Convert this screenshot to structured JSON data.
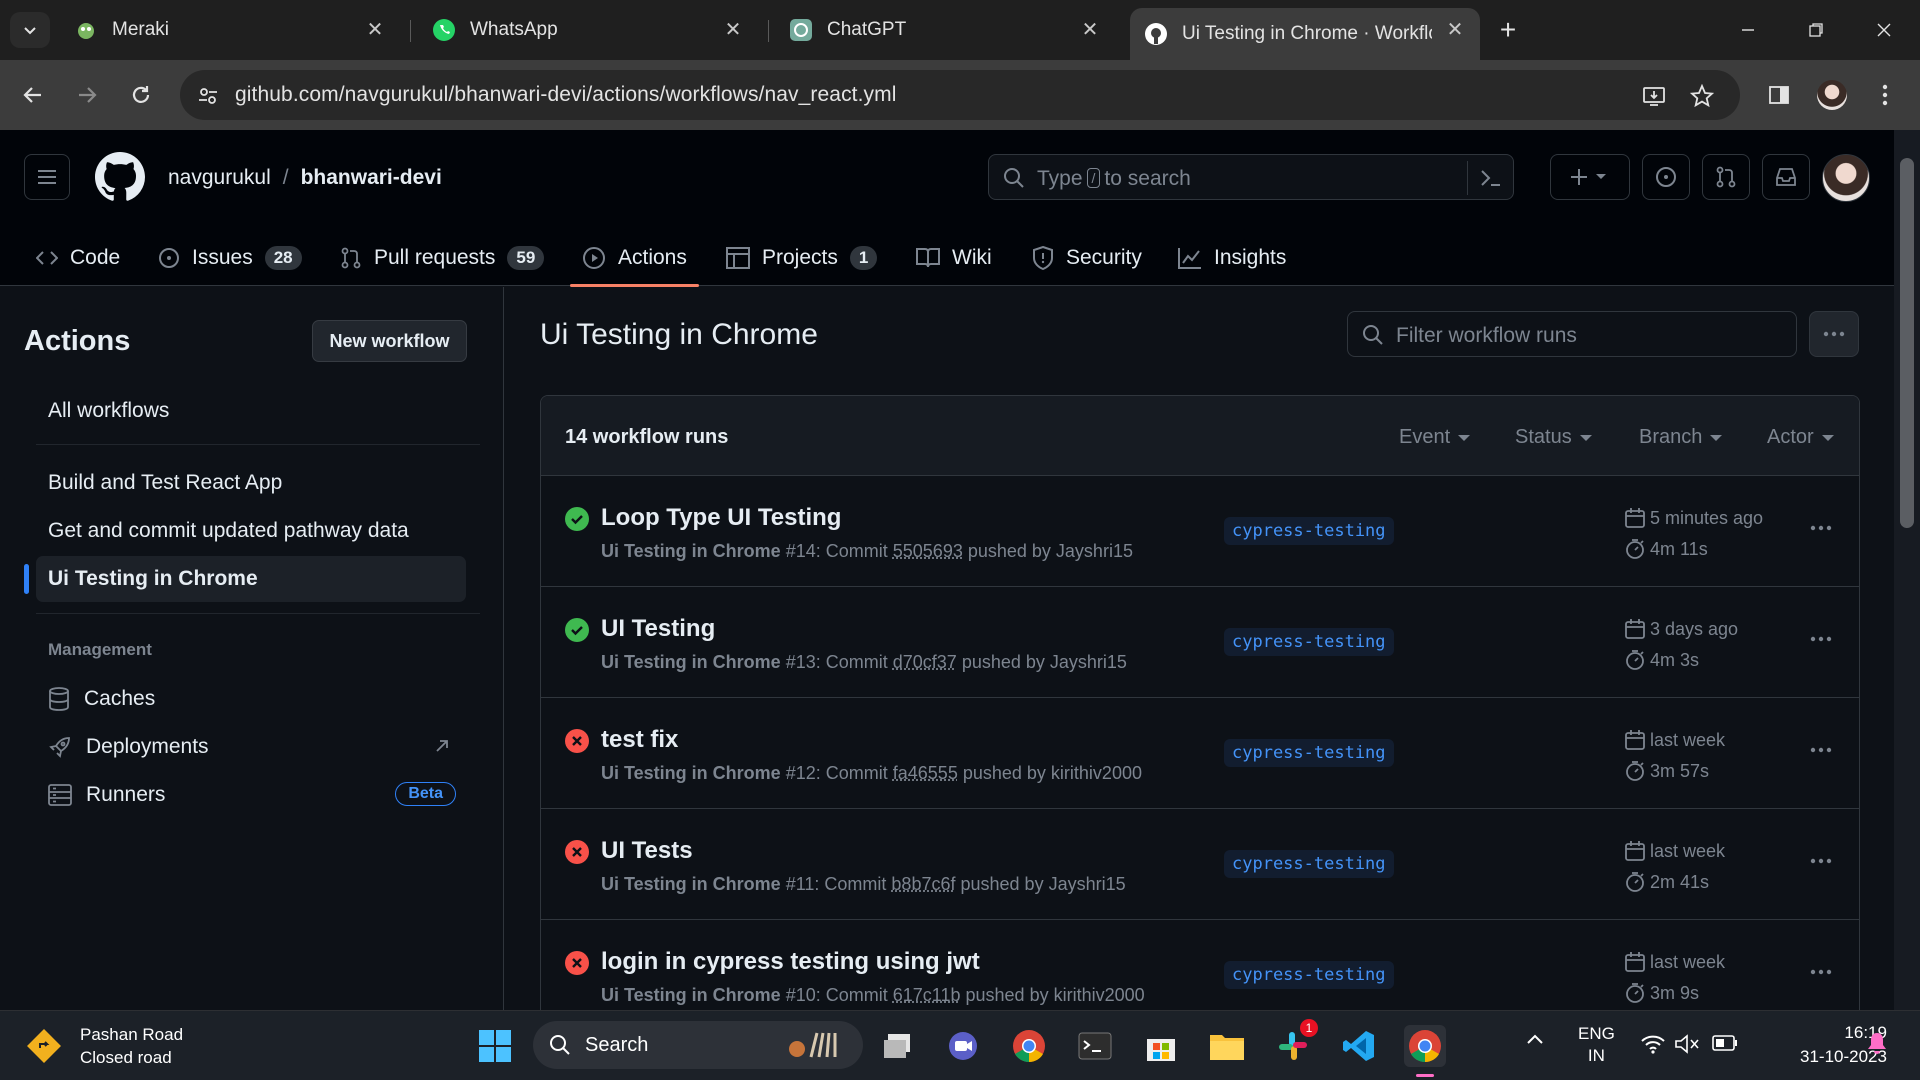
{
  "browser": {
    "tabs": [
      {
        "title": "Meraki"
      },
      {
        "title": "WhatsApp"
      },
      {
        "title": "ChatGPT"
      },
      {
        "title": "Ui Testing in Chrome · Workflo"
      }
    ],
    "url": "github.com/navgurukul/bhanwari-devi/actions/workflows/nav_react.yml"
  },
  "header": {
    "owner": "navgurukul",
    "separator": "/",
    "repo": "bhanwari-devi",
    "search_prefix": "Type",
    "search_key": "/",
    "search_suffix": "to search"
  },
  "repo_nav": [
    {
      "label": "Code",
      "icon": "code-icon"
    },
    {
      "label": "Issues",
      "count": "28",
      "icon": "issue-icon"
    },
    {
      "label": "Pull requests",
      "count": "59",
      "icon": "pull-request-icon"
    },
    {
      "label": "Actions",
      "icon": "play-icon",
      "active": true
    },
    {
      "label": "Projects",
      "count": "1",
      "icon": "table-icon"
    },
    {
      "label": "Wiki",
      "icon": "book-icon"
    },
    {
      "label": "Security",
      "icon": "shield-icon"
    },
    {
      "label": "Insights",
      "icon": "graph-icon"
    }
  ],
  "sidebar": {
    "title": "Actions",
    "new_workflow": "New workflow",
    "all_workflows": "All workflows",
    "workflows": [
      {
        "label": "Build and Test React App"
      },
      {
        "label": "Get and commit updated pathway data"
      },
      {
        "label": "Ui Testing in Chrome",
        "active": true
      }
    ],
    "management_heading": "Management",
    "management": [
      {
        "label": "Caches",
        "icon": "database-icon"
      },
      {
        "label": "Deployments",
        "icon": "rocket-icon"
      },
      {
        "label": "Runners",
        "icon": "server-icon",
        "badge": "Beta"
      }
    ]
  },
  "main": {
    "title": "Ui Testing in Chrome",
    "filter_placeholder": "Filter workflow runs",
    "runs_count": "14 workflow runs",
    "filters": [
      "Event",
      "Status",
      "Branch",
      "Actor"
    ],
    "runs": [
      {
        "status": "success",
        "title": "Loop Type UI Testing",
        "workflow": "Ui Testing in Chrome",
        "run": "#14: Commit",
        "commit": "5505693",
        "by": "pushed by Jayshri15",
        "branch": "cypress-testing",
        "when": "5 minutes ago",
        "duration": "4m 11s"
      },
      {
        "status": "success",
        "title": "UI Testing",
        "workflow": "Ui Testing in Chrome",
        "run": "#13: Commit",
        "commit": "d70cf37",
        "by": "pushed by Jayshri15",
        "branch": "cypress-testing",
        "when": "3 days ago",
        "duration": "4m 3s"
      },
      {
        "status": "failure",
        "title": "test fix",
        "workflow": "Ui Testing in Chrome",
        "run": "#12: Commit",
        "commit": "fa46555",
        "by": "pushed by kirithiv2000",
        "branch": "cypress-testing",
        "when": "last week",
        "duration": "3m 57s"
      },
      {
        "status": "failure",
        "title": "UI Tests",
        "workflow": "Ui Testing in Chrome",
        "run": "#11: Commit",
        "commit": "b8b7c6f",
        "by": "pushed by Jayshri15",
        "branch": "cypress-testing",
        "when": "last week",
        "duration": "2m 41s"
      },
      {
        "status": "failure",
        "title": "login in cypress testing using jwt",
        "workflow": "Ui Testing in Chrome",
        "run": "#10: Commit",
        "commit": "617c11b",
        "by": "pushed by kirithiv2000",
        "branch": "cypress-testing",
        "when": "last week",
        "duration": "3m 9s"
      }
    ]
  },
  "taskbar": {
    "weather_title": "Pashan Road",
    "weather_sub": "Closed road",
    "search": "Search",
    "lang1": "ENG",
    "lang2": "IN",
    "time": "16:19",
    "date": "31-10-2023",
    "slack_badge": "1"
  },
  "colors": {
    "success": "#3fb950",
    "failure": "#f85149",
    "accent": "#2f81f7",
    "underline": "#f78166"
  }
}
